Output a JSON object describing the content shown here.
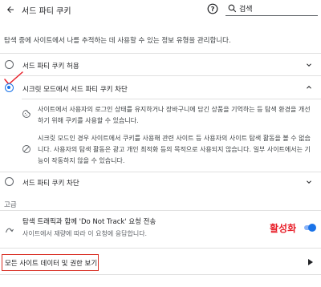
{
  "header": {
    "title": "서드 파티 쿠키",
    "search_value": "검색"
  },
  "description": "탐색 중에 사이트에서 나를 추적하는 데 사용할 수 있는 정보 유형을 관리합니다.",
  "options": [
    {
      "label": "서드 파티 쿠키 허용",
      "selected": false,
      "expanded": false
    },
    {
      "label": "시크릿 모드에서 서드 파티 쿠키 차단",
      "selected": true,
      "expanded": true
    },
    {
      "label": "서드 파티 쿠키 차단",
      "selected": false,
      "expanded": false
    }
  ],
  "expanded_details": [
    {
      "icon": "cookie-icon",
      "text": "사이트에서 사용자의 로그인 상태를 유지하거나 장바구니에 담긴 상품을 기억하는 등 탐색 환경을 개선하기 위해 쿠키를 사용할 수 있습니다."
    },
    {
      "icon": "block-icon",
      "text": "시크릿 모드인 경우 사이트에서 쿠키를 사용해 관련 사이트 등 사용자의 사이트 탐색 활동을 볼 수 없습니다. 사용자의 탐색 활동은 광고 개인 최적화 등의 목적으로 사용되지 않습니다. 일부 사이트에서는 기능이 작동하지 않을 수 있습니다."
    }
  ],
  "advanced": {
    "section_label": "고급",
    "dnt_title": "탐색 트래픽과 함께 'Do Not Track' 요청 전송",
    "dnt_subtitle": "사이트에서 재량에 따라 이 요청에 응답합니다.",
    "dnt_enabled": true,
    "annotation": "활성화"
  },
  "all_site_data": {
    "label": "모든 사이트 데이터 및 권한 보기"
  },
  "colors": {
    "accent": "#1a73e8",
    "annotation": "#e8202a",
    "highlight_border": "#d93025"
  }
}
